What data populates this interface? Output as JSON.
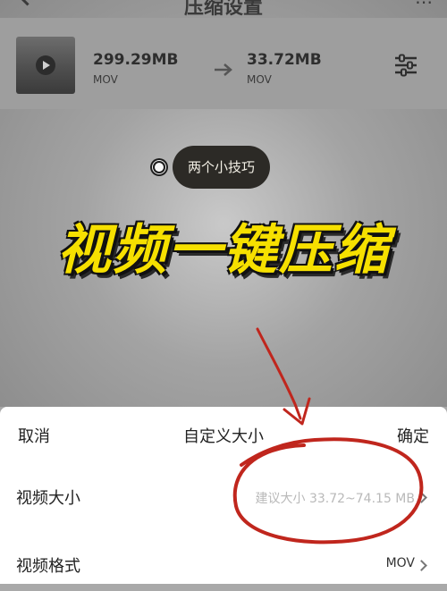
{
  "nav": {
    "title": "压缩设置"
  },
  "file": {
    "original_size": "299.29MB",
    "original_format": "MOV",
    "compressed_size": "33.72MB",
    "compressed_format": "MOV"
  },
  "overlay": {
    "tip": "两个小技巧",
    "headline": "视频一键压缩"
  },
  "sheet": {
    "cancel_label": "取消",
    "title": "自定义大小",
    "confirm_label": "确定",
    "rows": [
      {
        "label": "视频大小",
        "value": "建议大小 33.72~74.15 MB"
      },
      {
        "label": "视频格式",
        "value": "MOV"
      }
    ]
  },
  "colors": {
    "headline": "#f6e000",
    "annotation": "#c0261d",
    "accent_text": "#222222"
  }
}
